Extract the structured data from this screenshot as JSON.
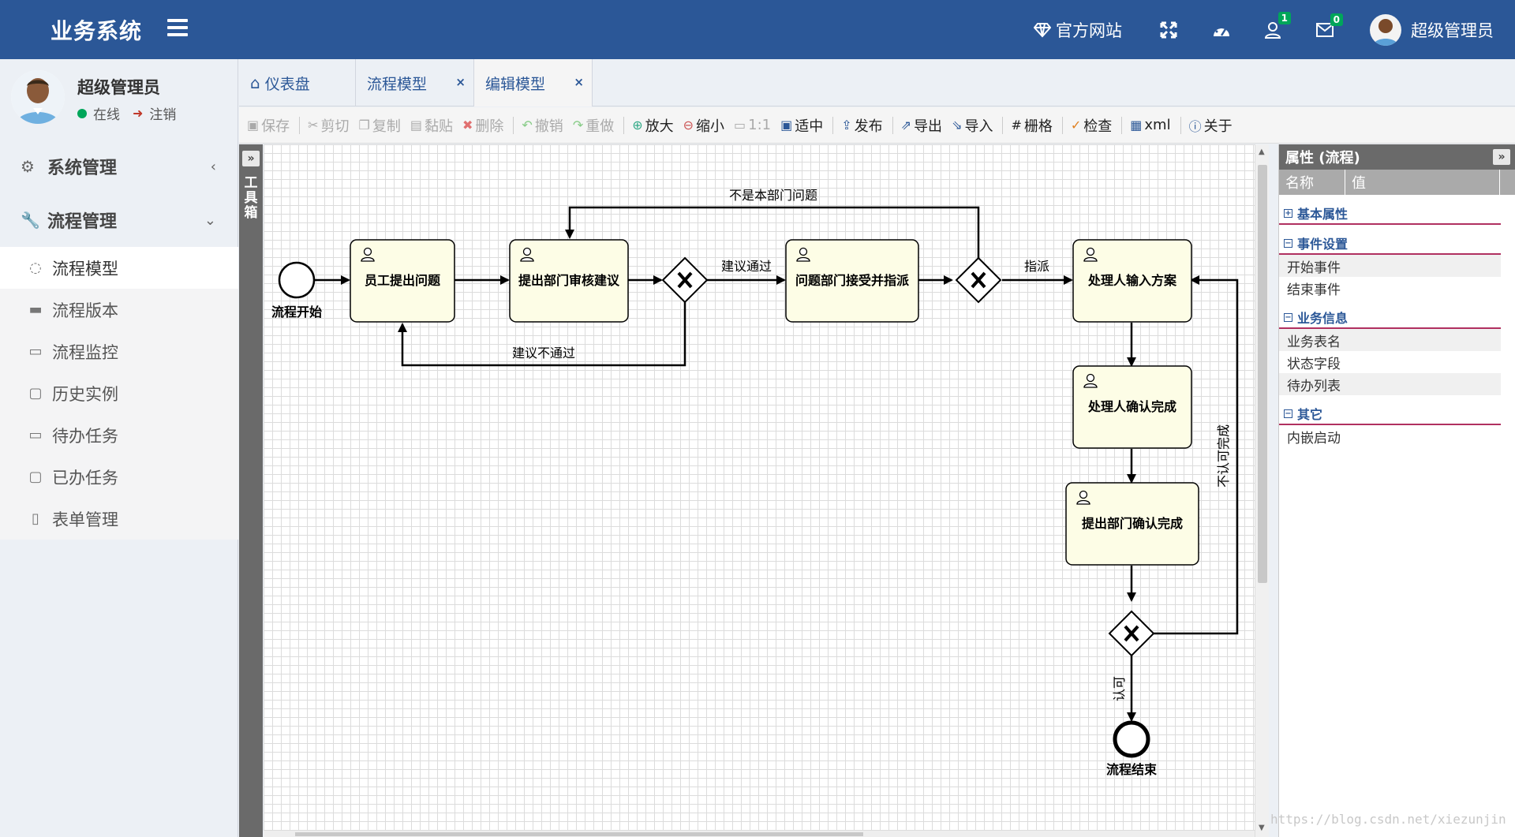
{
  "app": {
    "brand": "业务系统"
  },
  "topnav": {
    "website": "官方网站",
    "user_badge": "1",
    "mail_badge": "0",
    "username": "超级管理员"
  },
  "sidebar": {
    "user_name": "超级管理员",
    "status": "在线",
    "logout": "注销",
    "groups": [
      {
        "label": "系统管理"
      },
      {
        "label": "流程管理"
      }
    ],
    "items": [
      {
        "label": "流程模型"
      },
      {
        "label": "流程版本"
      },
      {
        "label": "流程监控"
      },
      {
        "label": "历史实例"
      },
      {
        "label": "待办任务"
      },
      {
        "label": "已办任务"
      },
      {
        "label": "表单管理"
      }
    ]
  },
  "tabs": [
    {
      "label": "仪表盘"
    },
    {
      "label": "流程模型"
    },
    {
      "label": "编辑模型"
    }
  ],
  "toolbar": {
    "save": "保存",
    "cut": "剪切",
    "copy": "复制",
    "paste": "黏贴",
    "delete": "删除",
    "undo": "撤销",
    "redo": "重做",
    "zoom_in": "放大",
    "zoom_out": "缩小",
    "actual": "1:1",
    "fit": "适中",
    "publish": "发布",
    "export": "导出",
    "import": "导入",
    "grid": "栅格",
    "check": "检查",
    "xml": "xml",
    "about": "关于"
  },
  "left_panel": {
    "label": "工具箱"
  },
  "diagram": {
    "start": "流程开始",
    "end": "流程结束",
    "tasks": {
      "t1": "员工提出问题",
      "t2": "提出部门审核建议",
      "t3": "问题部门接受并指派",
      "t4": "处理人输入方案",
      "t5": "处理人确认完成",
      "t6": "提出部门确认完成"
    },
    "flows": {
      "not_dept": "不是本部门问题",
      "approved": "建议通过",
      "assign": "指派",
      "rejected": "建议不通过",
      "not_confirm": "不认可完成",
      "confirm": "认可"
    }
  },
  "properties": {
    "title": "属性 (流程)",
    "col_name": "名称",
    "col_value": "值",
    "groups": [
      {
        "label": "基本属性",
        "rows": []
      },
      {
        "label": "事件设置",
        "rows": [
          "开始事件",
          "结束事件"
        ]
      },
      {
        "label": "业务信息",
        "rows": [
          "业务表名",
          "状态字段",
          "待办列表"
        ]
      },
      {
        "label": "其它",
        "rows": [
          "内嵌启动"
        ]
      }
    ]
  },
  "watermark": "https://blog.csdn.net/xiezunjin"
}
